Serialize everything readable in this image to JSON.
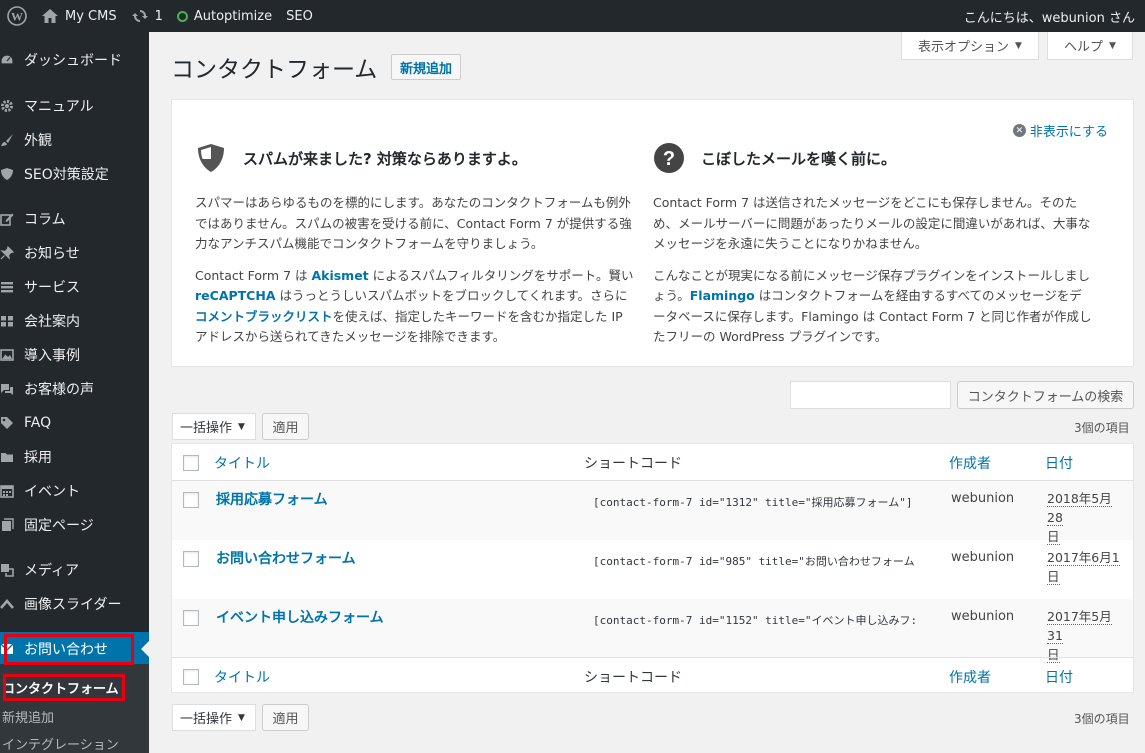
{
  "adminbar": {
    "site_name": "My CMS",
    "updates_count": "1",
    "plugin": "Autoptimize",
    "seo": "SEO",
    "greeting": "こんにちは、webunion さん"
  },
  "sidebar": {
    "items": [
      {
        "label": "ダッシュボード",
        "icon": "dashboard-icon"
      },
      {
        "label": "マニュアル",
        "icon": "gear-icon"
      },
      {
        "label": "外観",
        "icon": "brush-icon"
      },
      {
        "label": "SEO対策設定",
        "icon": "shield-icon"
      },
      {
        "label": "コラム",
        "icon": "edit-icon"
      },
      {
        "label": "お知らせ",
        "icon": "pin-icon"
      },
      {
        "label": "サービス",
        "icon": "list-icon"
      },
      {
        "label": "会社案内",
        "icon": "table-icon"
      },
      {
        "label": "導入事例",
        "icon": "images-icon"
      },
      {
        "label": "お客様の声",
        "icon": "chat-icon"
      },
      {
        "label": "FAQ",
        "icon": "tag-icon"
      },
      {
        "label": "採用",
        "icon": "folder-icon"
      },
      {
        "label": "イベント",
        "icon": "calendar-icon"
      },
      {
        "label": "固定ページ",
        "icon": "page-icon"
      },
      {
        "label": "メディア",
        "icon": "media-icon"
      },
      {
        "label": "画像スライダー",
        "icon": "slider-icon"
      },
      {
        "label": "お問い合わせ",
        "icon": "mail-icon"
      }
    ],
    "submenu": [
      "コンタクトフォーム",
      "新規追加",
      "インテグレーション"
    ]
  },
  "screen_options": "表示オプション",
  "help": "ヘルプ",
  "page_title": "コンタクトフォーム",
  "add_new": "新規追加",
  "welcome": {
    "dismiss": "非表示にする",
    "left": {
      "heading": "スパムが来ました? 対策ならありますよ。",
      "p1": "スパマーはあらゆるものを標的にします。あなたのコンタクトフォームも例外ではありません。スパムの被害を受ける前に、Contact Form 7 が提供する強力なアンチスパム機能でコンタクトフォームを守りましょう。",
      "p2_a": "Contact Form 7 は ",
      "p2_link1": "Akismet",
      "p2_b": " によるスパムフィルタリングをサポート。賢い ",
      "p2_link2": "reCAPTCHA",
      "p2_c": " はうっとうしいスパムボットをブロックしてくれます。さらに",
      "p2_link3": "コメントブラックリスト",
      "p2_d": "を使えば、指定したキーワードを含むか指定した IP アドレスから送られてきたメッセージを排除できます。"
    },
    "right": {
      "heading": "こぼしたメールを嘆く前に。",
      "p1": "Contact Form 7 は送信されたメッセージをどこにも保存しません。そのため、メールサーバーに問題があったりメールの設定に間違いがあれば、大事なメッセージを永遠に失うことになりかねません。",
      "p2_a": "こんなことが現実になる前にメッセージ保存プラグインをインストールしましょう。",
      "p2_link": "Flamingo",
      "p2_b": " はコンタクトフォームを経由するすべてのメッセージをデータベースに保存します。Flamingo は Contact Form 7 と同じ作者が作成したフリーの WordPress プラグインです。"
    }
  },
  "search": {
    "button": "コンタクトフォームの検索",
    "value": ""
  },
  "bulk": {
    "select": "一括操作",
    "apply": "適用",
    "count": "3個の項目"
  },
  "table": {
    "columns": {
      "title": "タイトル",
      "shortcode": "ショートコード",
      "author": "作成者",
      "date": "日付"
    },
    "rows": [
      {
        "title": "採用応募フォーム",
        "shortcode": "[contact-form-7 id=\"1312\" title=\"採用応募フォーム\"]",
        "author": "webunion",
        "date1": "2018年5月28",
        "date2": "日"
      },
      {
        "title": "お問い合わせフォーム",
        "shortcode": "[contact-form-7 id=\"985\" title=\"お問い合わせフォーム",
        "author": "webunion",
        "date1": "2017年6月1",
        "date2": "日"
      },
      {
        "title": "イベント申し込みフォーム",
        "shortcode": "[contact-form-7 id=\"1152\" title=\"イベント申し込みフ:",
        "author": "webunion",
        "date1": "2017年5月31",
        "date2": "日"
      }
    ]
  },
  "colors": {
    "accent": "#0073aa",
    "highlight": "#e60012",
    "sidebar": "#23282d"
  }
}
